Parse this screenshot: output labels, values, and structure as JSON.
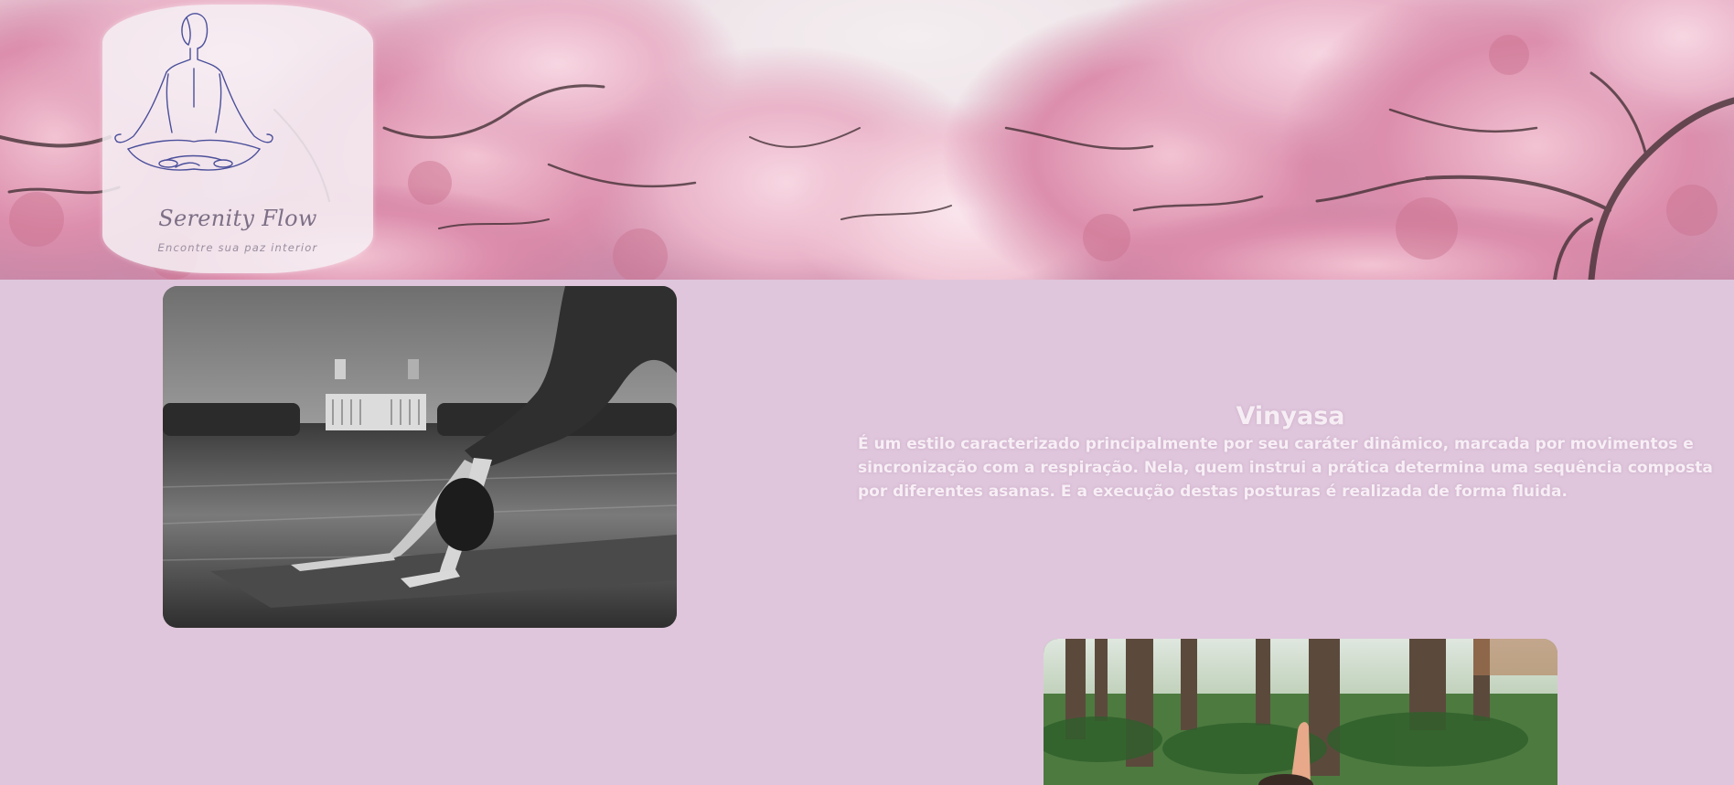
{
  "brand": {
    "name": "Serenity Flow",
    "tagline": "Encontre sua paz interior",
    "logo_icon": "meditation-lotus-figure-icon"
  },
  "hero": {
    "image": "cherry-blossom-banner"
  },
  "classes": [
    {
      "title": "Vinyasa",
      "description": "É um estilo caracterizado principalmente por seu caráter dinâmico, marcada por movimentos e sincronização com a respiração. Nela, quem instrui a prática determina uma sequência composta por diferentes asanas. E a execução destas posturas é realizada de forma fluida.",
      "image": "downward-dog-pose-photo"
    },
    {
      "image": "outdoor-forest-yoga-photo"
    }
  ],
  "colors": {
    "page_background": "#dfc6dc",
    "text_light": "#f7eff5",
    "logo_line": "#4a4f9a",
    "logo_text": "#7d6f86"
  }
}
